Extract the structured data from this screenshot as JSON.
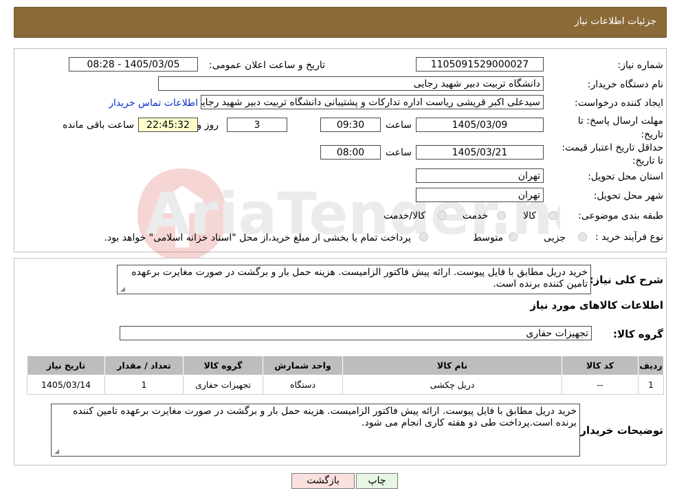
{
  "header": {
    "title": "جزئیات اطلاعات نیاز"
  },
  "form": {
    "need_number_label": "شماره نیاز:",
    "need_number": "1105091529000027",
    "announce_label": "تاریخ و ساعت اعلان عمومی:",
    "announce_value": "1405/03/05 - 08:28",
    "buyer_org_label": "نام دستگاه خریدار:",
    "buyer_org": "دانشگاه تربیت دبیر شهید رجایی",
    "creator_label": "ایجاد کننده درخواست:",
    "creator": "سیدعلی اکبر قریشی ریاست اداره تدارکات و پشتیبانی دانشگاه تربیت دبیر شهید رجایی",
    "contact_link": "اطلاعات تماس خریدار",
    "deadline_label": "مهلت ارسال پاسخ: تا تاریخ:",
    "deadline_date": "1405/03/09",
    "time_label": "ساعت",
    "deadline_time": "09:30",
    "days": "3",
    "days_label": "روز و",
    "remaining": "22:45:32",
    "remaining_label": "ساعت باقی مانده",
    "validity_label": "حداقل تاریخ اعتبار قیمت: تا تاریخ:",
    "validity_date": "1405/03/21",
    "validity_time": "08:00",
    "province_label": "استان محل تحویل:",
    "province": "تهران",
    "city_label": "شهر محل تحویل:",
    "city": "تهران",
    "category_label": "طبقه بندی موضوعی:",
    "category_options": [
      "کالا",
      "خدمت",
      "کالا/خدمت"
    ],
    "purchase_type_label": "نوع فرآیند خرید :",
    "purchase_options": [
      "جزیی",
      "متوسط"
    ],
    "purchase_note": "پرداخت تمام یا بخشی از مبلغ خرید،از محل \"اسناد خزانه اسلامی\" خواهد بود."
  },
  "details": {
    "summary_label": "شرح کلی نیاز:",
    "summary": "خرید دریل مطابق با فایل پیوست. ارائه پیش فاکتور الزامیست. هزینه حمل بار و برگشت در صورت مغایرت برعهده تامین کننده برنده است.",
    "goods_info_title": "اطلاعات کالاهای مورد نیاز",
    "goods_group_label": "گروه کالا:",
    "goods_group": "تجهیزات حفاری",
    "table": {
      "headers": [
        "ردیف",
        "کد کالا",
        "نام کالا",
        "واحد شمارش",
        "گروه کالا",
        "تعداد / مقدار",
        "تاریخ نیاز"
      ],
      "rows": [
        [
          "1",
          "--",
          "دریل چکشی",
          "دستگاه",
          "تجهیزات حفاری",
          "1",
          "1405/03/14"
        ]
      ]
    },
    "buyer_notes_label": "توضیحات خریدار:",
    "buyer_notes": "خرید دریل مطابق با فایل پیوست. ارائه پیش فاکتور الزامیست. هزینه حمل بار و برگشت در صورت مغایرت برعهده تامین کننده برنده است.پرداخت طی دو هفته کاری انجام می شود."
  },
  "buttons": {
    "print": "چاپ",
    "back": "بازگشت"
  },
  "colors": {
    "header": "#8B6A38",
    "remaining_bg": "#ffffcc",
    "back_bg": "#fbe0e0",
    "print_bg": "#e6f7e6"
  }
}
